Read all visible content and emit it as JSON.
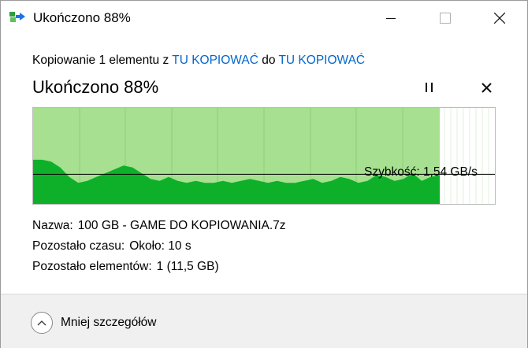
{
  "window": {
    "title": "Ukończono 88%",
    "app_icon": "file-copy-icon",
    "controls": [
      "minimize-icon",
      "maximize-icon",
      "close-icon"
    ]
  },
  "copy": {
    "prefix": "Kopiowanie 1 elementu z ",
    "source": "TU KOPIOWAĆ",
    "middle": " do ",
    "destination": "TU KOPIOWAĆ"
  },
  "progress": {
    "title": "Ukończono 88%",
    "percent": 88,
    "pause_icon": "pause-icon",
    "cancel_icon": "cancel-icon"
  },
  "speed": {
    "label": "Szybkość: 1,54 GB/s",
    "value_gbps": 1.54,
    "history_gbps": [
      2.3,
      2.3,
      2.2,
      1.9,
      1.4,
      1.1,
      1.2,
      1.4,
      1.6,
      1.8,
      2.0,
      1.9,
      1.6,
      1.3,
      1.2,
      1.4,
      1.2,
      1.1,
      1.2,
      1.1,
      1.1,
      1.2,
      1.1,
      1.2,
      1.3,
      1.2,
      1.1,
      1.2,
      1.1,
      1.1,
      1.2,
      1.3,
      1.1,
      1.2,
      1.4,
      1.3,
      1.1,
      1.2,
      1.5,
      1.4,
      1.2,
      1.3,
      1.6,
      1.2,
      1.4,
      1.5
    ]
  },
  "details": {
    "name_label": "Nazwa:",
    "name_value": "100 GB - GAME DO KOPIOWANIA.7z",
    "time_label": "Pozostało czasu:",
    "time_value": "Około: 10 s",
    "items_label": "Pozostało elementów:",
    "items_value": "1 (11,5 GB)"
  },
  "footer": {
    "less_details_label": "Mniej szczegółów",
    "icon": "chevron-up-icon"
  },
  "colors": {
    "link": "#0066cc",
    "graph_fill_light": "#a6e090",
    "graph_fill_dark": "#0eb02a",
    "graph_grid": "#8fcf78"
  }
}
